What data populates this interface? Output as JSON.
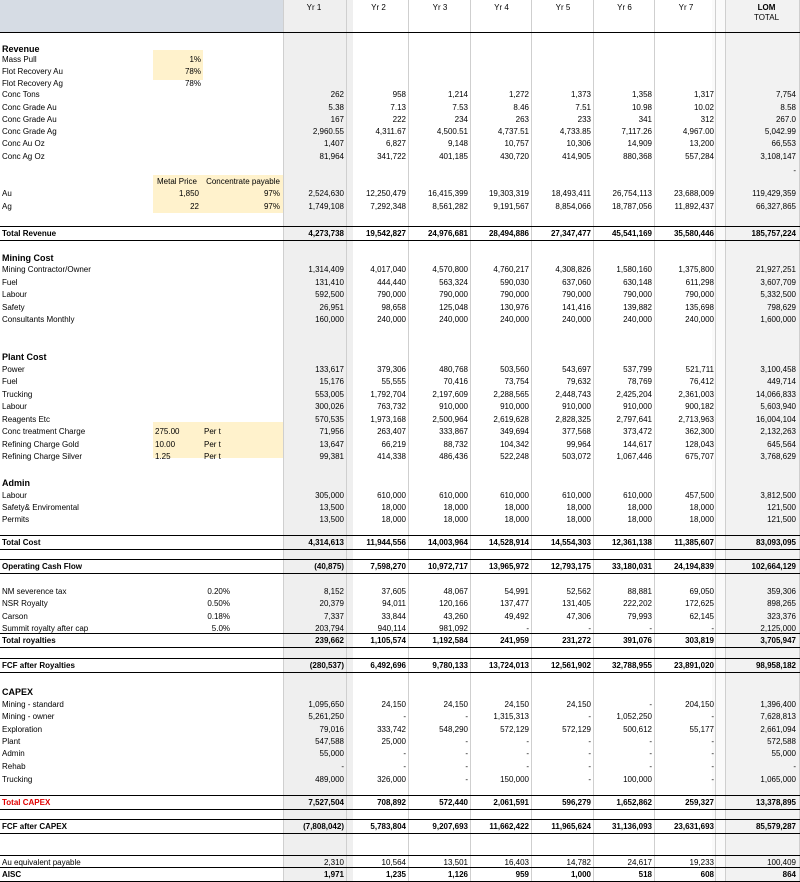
{
  "headers": {
    "years": [
      "Yr 1",
      "Yr 2",
      "Yr 3",
      "Yr 4",
      "Yr 5",
      "Yr 6",
      "Yr 7"
    ],
    "lom": "LOM",
    "total": "TOTAL"
  },
  "inputs_revenue": [
    {
      "label": "Mass Pull",
      "input": "1%"
    },
    {
      "label": "Flot Recovery Au",
      "input": "78%"
    },
    {
      "label": "Flot Recovery Ag",
      "input": "78%"
    }
  ],
  "price_header": {
    "metal_price": "Metal Price",
    "conc_payable": "Concentrate payable"
  },
  "prices": [
    {
      "label": "Au",
      "price": "1,850",
      "payable": "97%"
    },
    {
      "label": "Ag",
      "price": "22",
      "payable": "97%"
    }
  ],
  "cost_inputs": [
    {
      "price": "275.00",
      "unit": "Per t"
    },
    {
      "price": "10.00",
      "unit": "Per t"
    },
    {
      "price": "1.25",
      "unit": "Per t"
    }
  ],
  "royalty_rates": [
    "0.20%",
    "0.50%",
    "0.18%",
    "5.0%"
  ],
  "rows": [
    {
      "label": "Revenue",
      "section": true
    },
    {
      "label": "Mass Pull"
    },
    {
      "label": "Flot Recovery Au"
    },
    {
      "label": "Flot Recovery Ag"
    },
    {
      "label": "Conc Tons",
      "v": [
        "262",
        "958",
        "1,214",
        "1,272",
        "1,373",
        "1,358",
        "1,317"
      ],
      "t": "7,754"
    },
    {
      "label": "Conc Grade Au",
      "v": [
        "5.38",
        "7.13",
        "7.53",
        "8.46",
        "7.51",
        "10.98",
        "10.02"
      ],
      "t": "8.58"
    },
    {
      "label": "Conc Grade Au",
      "v": [
        "167",
        "222",
        "234",
        "263",
        "233",
        "341",
        "312"
      ],
      "t": "267.0"
    },
    {
      "label": "Conc Grade Ag",
      "v": [
        "2,960.55",
        "4,311.67",
        "4,500.51",
        "4,737.51",
        "4,733.85",
        "7,117.26",
        "4,967.00"
      ],
      "t": "5,042.99"
    },
    {
      "label": "Conc Au Oz",
      "v": [
        "1,407",
        "6,827",
        "9,148",
        "10,757",
        "10,306",
        "14,909",
        "13,200"
      ],
      "t": "66,553"
    },
    {
      "label": "Conc Ag Oz",
      "v": [
        "81,964",
        "341,722",
        "401,185",
        "430,720",
        "414,905",
        "880,368",
        "557,284"
      ],
      "t": "3,108,147"
    },
    {
      "label": "",
      "t": "-"
    },
    {
      "label": "Au",
      "v": [
        "2,524,630",
        "12,250,479",
        "16,415,399",
        "19,303,319",
        "18,493,411",
        "26,754,113",
        "23,688,009"
      ],
      "t": "119,429,359"
    },
    {
      "label": "Ag",
      "v": [
        "1,749,108",
        "7,292,348",
        "8,561,282",
        "9,191,567",
        "8,854,066",
        "18,787,056",
        "11,892,437"
      ],
      "t": "66,327,865"
    },
    {
      "label": "Total Revenue",
      "bold": true,
      "v": [
        "4,273,738",
        "19,542,827",
        "24,976,681",
        "28,494,886",
        "27,347,477",
        "45,541,169",
        "35,580,446"
      ],
      "t": "185,757,224"
    },
    {
      "label": "Mining Cost",
      "section": true
    },
    {
      "label": "Mining Contractor/Owner",
      "v": [
        "1,314,409",
        "4,017,040",
        "4,570,800",
        "4,760,217",
        "4,308,826",
        "1,580,160",
        "1,375,800"
      ],
      "t": "21,927,251"
    },
    {
      "label": "Fuel",
      "v": [
        "131,410",
        "444,440",
        "563,324",
        "590,030",
        "637,060",
        "630,148",
        "611,298"
      ],
      "t": "3,607,709"
    },
    {
      "label": "Labour",
      "v": [
        "592,500",
        "790,000",
        "790,000",
        "790,000",
        "790,000",
        "790,000",
        "790,000"
      ],
      "t": "5,332,500"
    },
    {
      "label": "Safety",
      "v": [
        "26,951",
        "98,658",
        "125,048",
        "130,976",
        "141,416",
        "139,882",
        "135,698"
      ],
      "t": "798,629"
    },
    {
      "label": "Consultants Monthly",
      "v": [
        "160,000",
        "240,000",
        "240,000",
        "240,000",
        "240,000",
        "240,000",
        "240,000"
      ],
      "t": "1,600,000"
    },
    {
      "label": "Plant Cost",
      "section": true
    },
    {
      "label": "Power",
      "v": [
        "133,617",
        "379,306",
        "480,768",
        "503,560",
        "543,697",
        "537,799",
        "521,711"
      ],
      "t": "3,100,458"
    },
    {
      "label": "Fuel",
      "v": [
        "15,176",
        "55,555",
        "70,416",
        "73,754",
        "79,632",
        "78,769",
        "76,412"
      ],
      "t": "449,714"
    },
    {
      "label": "Trucking",
      "v": [
        "553,005",
        "1,792,704",
        "2,197,609",
        "2,288,565",
        "2,448,743",
        "2,425,204",
        "2,361,003"
      ],
      "t": "14,066,833"
    },
    {
      "label": "Labour",
      "v": [
        "300,026",
        "763,732",
        "910,000",
        "910,000",
        "910,000",
        "910,000",
        "900,182"
      ],
      "t": "5,603,940"
    },
    {
      "label": "Reagents Etc",
      "v": [
        "570,535",
        "1,973,168",
        "2,500,964",
        "2,619,628",
        "2,828,325",
        "2,797,641",
        "2,713,963"
      ],
      "t": "16,004,104"
    },
    {
      "label": "Conc treatment Charge",
      "v": [
        "71,956",
        "263,407",
        "333,867",
        "349,694",
        "377,568",
        "373,472",
        "362,300"
      ],
      "t": "2,132,263"
    },
    {
      "label": "Refining Charge Gold",
      "v": [
        "13,647",
        "66,219",
        "88,732",
        "104,342",
        "99,964",
        "144,617",
        "128,043"
      ],
      "t": "645,564"
    },
    {
      "label": "Refining Charge Silver",
      "v": [
        "99,381",
        "414,338",
        "486,436",
        "522,248",
        "503,072",
        "1,067,446",
        "675,707"
      ],
      "t": "3,768,629"
    },
    {
      "label": "Admin",
      "section": true
    },
    {
      "label": "Labour",
      "v": [
        "305,000",
        "610,000",
        "610,000",
        "610,000",
        "610,000",
        "610,000",
        "457,500"
      ],
      "t": "3,812,500"
    },
    {
      "label": "Safety& Enviromental",
      "v": [
        "13,500",
        "18,000",
        "18,000",
        "18,000",
        "18,000",
        "18,000",
        "18,000"
      ],
      "t": "121,500"
    },
    {
      "label": "Permits",
      "v": [
        "13,500",
        "18,000",
        "18,000",
        "18,000",
        "18,000",
        "18,000",
        "18,000"
      ],
      "t": "121,500"
    },
    {
      "label": "Total Cost",
      "bold": true,
      "v": [
        "4,314,613",
        "11,944,556",
        "14,003,964",
        "14,528,914",
        "14,554,303",
        "12,361,138",
        "11,385,607"
      ],
      "t": "83,093,095"
    },
    {
      "label": "Operating Cash Flow",
      "bold": true,
      "v": [
        "(40,875)",
        "7,598,270",
        "10,972,717",
        "13,965,972",
        "12,793,175",
        "33,180,031",
        "24,194,839"
      ],
      "t": "102,664,129"
    },
    {
      "label": "NM severence tax",
      "v": [
        "8,152",
        "37,605",
        "48,067",
        "54,991",
        "52,562",
        "88,881",
        "69,050"
      ],
      "t": "359,306"
    },
    {
      "label": "NSR Royalty",
      "v": [
        "20,379",
        "94,011",
        "120,166",
        "137,477",
        "131,405",
        "222,202",
        "172,625"
      ],
      "t": "898,265"
    },
    {
      "label": "Carson",
      "v": [
        "7,337",
        "33,844",
        "43,260",
        "49,492",
        "47,306",
        "79,993",
        "62,145"
      ],
      "t": "323,376"
    },
    {
      "label": "Summit royalty after cap",
      "v": [
        "203,794",
        "940,114",
        "981,092",
        "-",
        "-",
        "-",
        "-"
      ],
      "t": "2,125,000"
    },
    {
      "label": "Total royalties",
      "bold": true,
      "v": [
        "239,662",
        "1,105,574",
        "1,192,584",
        "241,959",
        "231,272",
        "391,076",
        "303,819"
      ],
      "t": "3,705,947"
    },
    {
      "label": "FCF after Royalties",
      "bold": true,
      "v": [
        "(280,537)",
        "6,492,696",
        "9,780,133",
        "13,724,013",
        "12,561,902",
        "32,788,955",
        "23,891,020"
      ],
      "t": "98,958,182"
    },
    {
      "label": "CAPEX",
      "section": true
    },
    {
      "label": "Mining - standard",
      "v": [
        "1,095,650",
        "24,150",
        "24,150",
        "24,150",
        "24,150",
        "-",
        "204,150"
      ],
      "t": "1,396,400"
    },
    {
      "label": "Mining - owner",
      "v": [
        "5,261,250",
        "-",
        "-",
        "1,315,313",
        "-",
        "1,052,250",
        "-"
      ],
      "t": "7,628,813"
    },
    {
      "label": "Exploration",
      "v": [
        "79,016",
        "333,742",
        "548,290",
        "572,129",
        "572,129",
        "500,612",
        "55,177"
      ],
      "t": "2,661,094"
    },
    {
      "label": "Plant",
      "v": [
        "547,588",
        "25,000",
        "-",
        "-",
        "-",
        "-",
        "-"
      ],
      "t": "572,588"
    },
    {
      "label": "Admin",
      "v": [
        "55,000",
        "-",
        "-",
        "-",
        "-",
        "-",
        "-"
      ],
      "t": "55,000"
    },
    {
      "label": "Rehab",
      "v": [
        "-",
        "-",
        "-",
        "-",
        "-",
        "-",
        "-"
      ],
      "t": "-"
    },
    {
      "label": "Trucking",
      "v": [
        "489,000",
        "326,000",
        "-",
        "150,000",
        "-",
        "100,000",
        "-"
      ],
      "t": "1,065,000"
    },
    {
      "label": "Total CAPEX",
      "bold": true,
      "red": true,
      "v": [
        "7,527,504",
        "708,892",
        "572,440",
        "2,061,591",
        "596,279",
        "1,652,862",
        "259,327"
      ],
      "t": "13,378,895"
    },
    {
      "label": "FCF after CAPEX",
      "bold": true,
      "v": [
        "(7,808,042)",
        "5,783,804",
        "9,207,693",
        "11,662,422",
        "11,965,624",
        "31,136,093",
        "23,631,693"
      ],
      "t": "85,579,287"
    },
    {
      "label": "Au equivalent payable",
      "v": [
        "2,310",
        "10,564",
        "13,501",
        "16,403",
        "14,782",
        "24,617",
        "19,233"
      ],
      "t": "100,409"
    },
    {
      "label": "AISC",
      "bold": true,
      "v": [
        "1,971",
        "1,235",
        "1,126",
        "959",
        "1,000",
        "518",
        "608"
      ],
      "t": "864"
    }
  ]
}
